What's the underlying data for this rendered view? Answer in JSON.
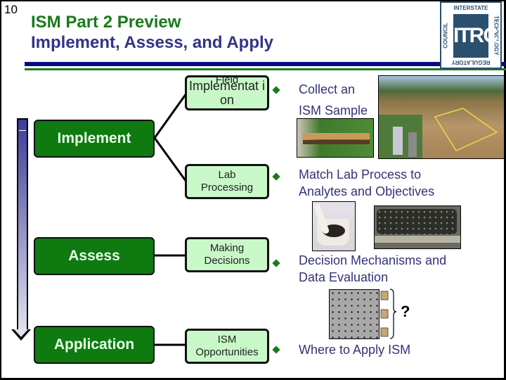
{
  "slide": {
    "number": "10",
    "title_line1": "ISM Part 2 Preview",
    "title_line2": "Implement, Assess, and Apply"
  },
  "logo": {
    "top": "INTERSTATE",
    "right": "TECHNOLOGY",
    "bottom": "REGULATORY",
    "left": "COUNCIL",
    "mark": "ITRC"
  },
  "colors": {
    "title_green": "#1a7a1a",
    "title_blue": "#333388",
    "phase_box": "#0e7a10",
    "sub_box": "#c8f8c8",
    "bullet_text": "#333377"
  },
  "phases": [
    {
      "label": "Implement"
    },
    {
      "label": "Assess"
    },
    {
      "label": "Application"
    }
  ],
  "steps": [
    {
      "label_over": "Field",
      "label": "Implementat ion",
      "bullet": [
        "Collect an",
        "ISM Sample"
      ]
    },
    {
      "label": "Lab Processing",
      "bullet": [
        "Match Lab Process to",
        "Analytes and Objectives"
      ]
    },
    {
      "label": "Making Decisions",
      "bullet": [
        "Decision Mechanisms and",
        "Data Evaluation"
      ]
    },
    {
      "label": "ISM Opportunities",
      "bullet": [
        "Where to Apply ISM"
      ]
    }
  ],
  "images": {
    "field_photo": "field sampling grid photo",
    "core_photo": "soil core in sampler",
    "mortar_photo": "mortar and pestle",
    "tray_photo": "soil sample tray",
    "decision_graphic": "sample grid with replicate jars"
  },
  "question_mark": "?"
}
